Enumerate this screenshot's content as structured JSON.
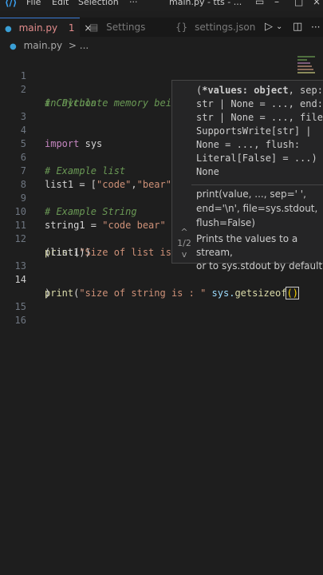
{
  "window": {
    "menu": [
      "File",
      "Edit",
      "Selection",
      "···"
    ],
    "title": "main.py - tts - ...",
    "logo": "VS Code logo"
  },
  "tabs": [
    {
      "label": "main.py",
      "modified_count": "1",
      "close": "×"
    },
    {
      "label": "Settings",
      "icon": "settings-icon"
    },
    {
      "label": "settings.json",
      "icon": "json-icon"
    }
  ],
  "breadcrumb": {
    "file": "main.py",
    "more": "> ..."
  },
  "editor": {
    "current_line": 14,
    "lines": [
      {
        "n": "1"
      },
      {
        "n": "2"
      },
      {
        "n": "3"
      },
      {
        "n": "4"
      },
      {
        "n": "5"
      },
      {
        "n": "6"
      },
      {
        "n": "7"
      },
      {
        "n": "8"
      },
      {
        "n": "9"
      },
      {
        "n": "10"
      },
      {
        "n": "11"
      },
      {
        "n": "12"
      },
      {
        "n": "13"
      },
      {
        "n": "14"
      },
      {
        "n": "15"
      },
      {
        "n": "16"
      }
    ],
    "code": {
      "c1": "# Calculate memory being used by an object",
      "c2": "in Python",
      "imp_kw": "import",
      "imp_mod": "sys",
      "c_list": "# Example list",
      "l7_a": "list1 = [",
      "l7_b": "\"code\"",
      "l7_c": ",",
      "l7_d": "\"bear\"",
      "l7_e": "]",
      "c_str": "# Example String",
      "l10_a": "string1 = ",
      "l10_b": "\"code bear\"",
      "l10_cursor": "I",
      "l12_fn": "print",
      "l12_a": "(",
      "l12_b": "\"Size of list is ",
      "l12c": "(list1))",
      "l14_fn": "print",
      "l14_a": "(",
      "l14_b": "\"size of string is : \"",
      "l14_c": " sys.",
      "l14_d": "getsizeof",
      "l14_e": "()",
      "l14c": ")"
    }
  },
  "hover": {
    "signature_lines": [
      "(*values: object, sep:",
      "str | None = ..., end:",
      "str | None = ..., file:",
      "SupportsWrite[str] |",
      "None = ..., flush:",
      "Literal[False] = ...) -",
      "None"
    ],
    "sig_bold": "*values: object",
    "doc_lines": [
      "print(value, ..., sep=' ',",
      "end='\\n', file=sys.stdout,",
      "flush=False)"
    ],
    "desc_lines": [
      "Prints the values to a stream,",
      "or to sys.stdout by default."
    ],
    "overload": "1/2",
    "up": "^",
    "down": "v"
  },
  "colors": {
    "bg": "#1e1e1e",
    "comment": "#6a9955",
    "keyword": "#c586c0",
    "string": "#ce9178",
    "function": "#dcdcaa",
    "active_tab": "#e38c8c"
  }
}
